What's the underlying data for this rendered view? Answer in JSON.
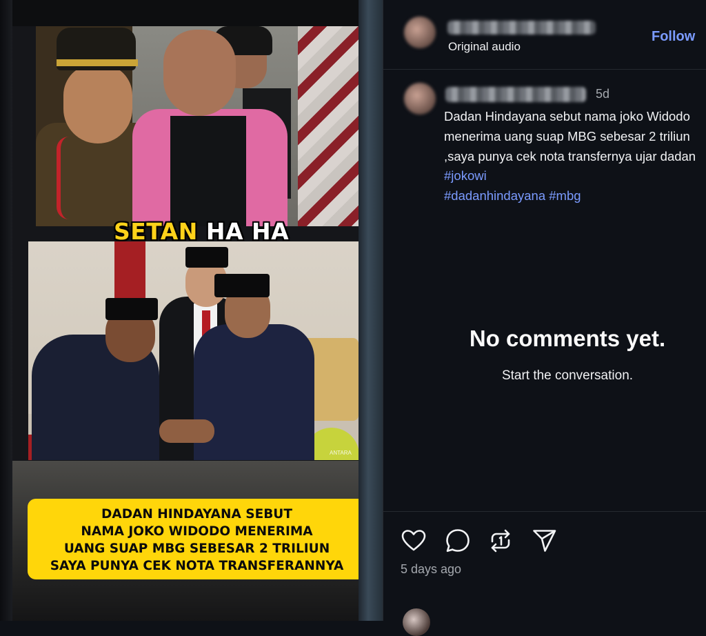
{
  "media": {
    "overlay_caption_yellow": "SETAN",
    "overlay_caption_white": " HA HA",
    "photo_watermark": "ANTARA",
    "banner_lines": [
      "DADAN HINDAYANA SEBUT",
      "NAMA JOKO WIDODO MENERIMA",
      "UANG SUAP MBG SEBESAR 2 TRILIUN",
      "SAYA PUNYA CEK NOTA TRANSFERANNYA"
    ]
  },
  "header": {
    "audio_label": "Original audio",
    "follow_label": "Follow"
  },
  "post": {
    "time_short": "5d",
    "caption_text": "Dadan Hindayana sebut nama joko Widodo menerima uang suap MBG sebesar 2 triliun ,saya punya cek nota transfernya ujar dadan ",
    "hashtags": [
      "#jokowi",
      "#dadanhindayana",
      "#mbg"
    ]
  },
  "comments": {
    "empty_title": "No comments yet.",
    "empty_subtitle": "Start the conversation."
  },
  "actions": {
    "icons": [
      "heart-icon",
      "comment-icon",
      "repost-icon",
      "share-icon"
    ],
    "timestamp": "5 days ago"
  },
  "colors": {
    "background": "#0e1117",
    "link": "#7b9bff",
    "banner_yellow": "#ffd60a"
  }
}
